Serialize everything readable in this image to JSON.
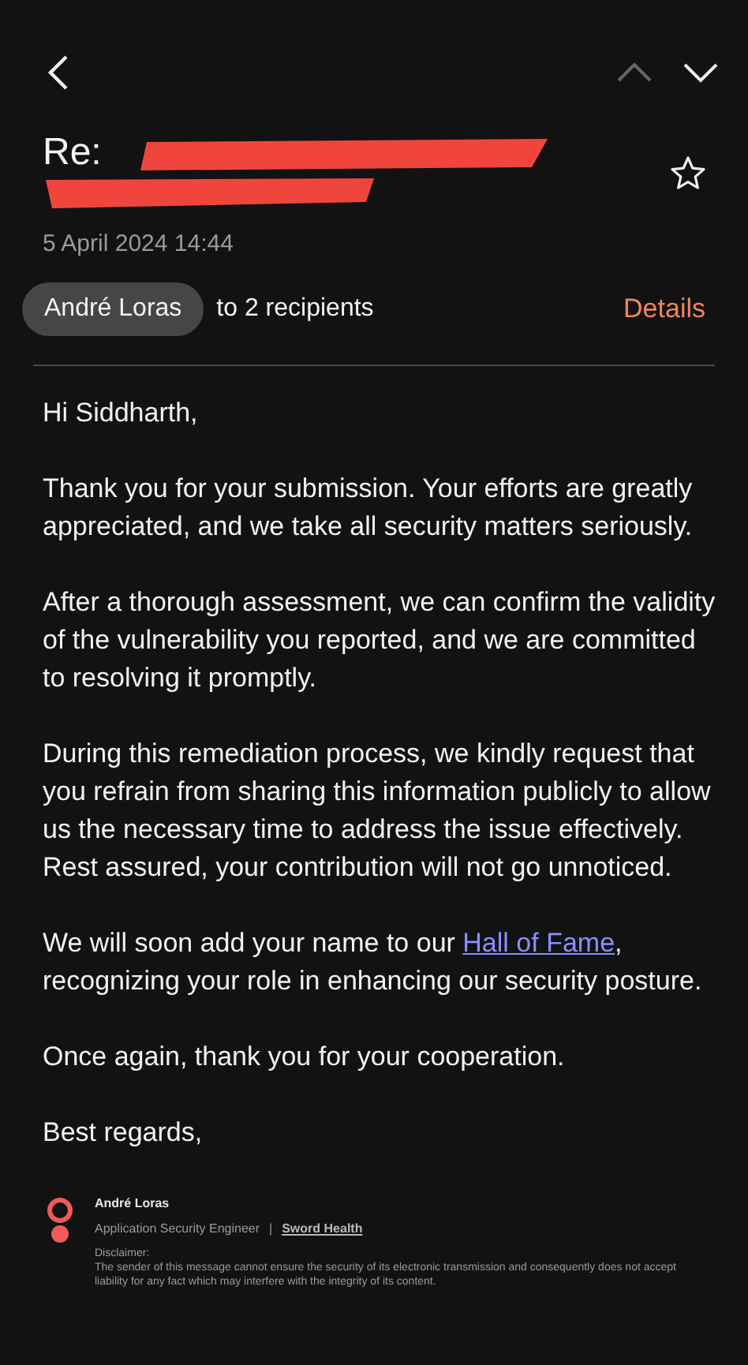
{
  "subject": "Re:",
  "date": "5 April 2024  14:44",
  "starred": false,
  "sender": "André Loras",
  "recipients": "to 2 recipients",
  "details": "Details",
  "greeting": "Hi Siddharth,",
  "paragraphs": [
    {
      "parts": [
        {
          "text": "Thank you for your submission. Your efforts are greatly appreciated, and we take all security matters seriously."
        }
      ]
    },
    {
      "parts": [
        {
          "text": "After a thorough assessment, we can confirm the validity of the vulnerability you reported, and we are committed to resolving it promptly."
        }
      ]
    },
    {
      "parts": [
        {
          "text": "During this remediation process, we kindly request that you refrain from sharing this information publicly to allow us the necessary time to address the issue effectively. Rest assured, your contribution will not go unnoticed."
        }
      ]
    },
    {
      "parts": [
        {
          "text": "We will soon add your name to our "
        },
        {
          "text": "Hall of Fame",
          "kind": "link"
        },
        {
          "text": ", recognizing your role in enhancing our security posture."
        }
      ]
    },
    {
      "parts": [
        {
          "text": "Once again, thank you for your cooperation."
        }
      ]
    }
  ],
  "closing": "Best regards,",
  "signature": {
    "name": "André Loras",
    "role": "Application Security Engineer",
    "separator": "|",
    "company": "Sword Health",
    "disclaimer_title": "Disclaimer:",
    "disclaimer": "The sender of this message cannot ensure the security of its electronic transmission and consequently does not accept liability for any fact which may interfere with the integrity of its content."
  }
}
